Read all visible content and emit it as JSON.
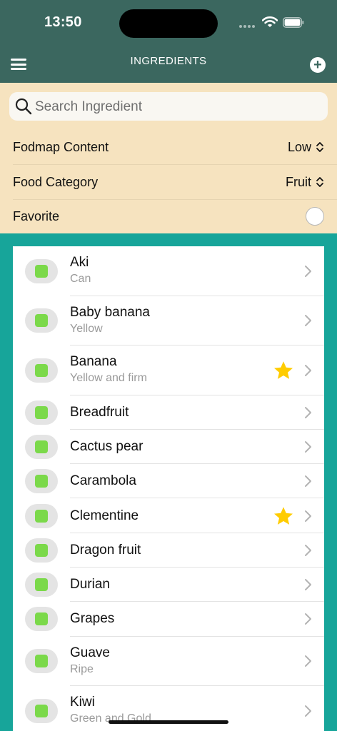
{
  "status_bar": {
    "time": "13:50"
  },
  "header": {
    "title": "INGREDIENTS",
    "add_label": "+"
  },
  "search": {
    "placeholder": "Search Ingredient"
  },
  "filters": {
    "fodmap": {
      "label": "Fodmap Content",
      "value": "Low"
    },
    "category": {
      "label": "Food Category",
      "value": "Fruit"
    },
    "favorite": {
      "label": "Favorite"
    }
  },
  "colors": {
    "header": "#3b675f",
    "filters_bg": "#f6e3bf",
    "page_bg": "#17a59a",
    "low_indicator": "#7bd94a",
    "star": "#ffcc00"
  },
  "ingredients": [
    {
      "name": "Aki",
      "detail": "Can",
      "favorite": false
    },
    {
      "name": "Baby banana",
      "detail": "Yellow",
      "favorite": false
    },
    {
      "name": "Banana",
      "detail": "Yellow and firm",
      "favorite": true
    },
    {
      "name": "Breadfruit",
      "detail": "",
      "favorite": false
    },
    {
      "name": "Cactus pear",
      "detail": "",
      "favorite": false
    },
    {
      "name": "Carambola",
      "detail": "",
      "favorite": false
    },
    {
      "name": "Clementine",
      "detail": "",
      "favorite": true
    },
    {
      "name": "Dragon fruit",
      "detail": "",
      "favorite": false
    },
    {
      "name": "Durian",
      "detail": "",
      "favorite": false
    },
    {
      "name": "Grapes",
      "detail": "",
      "favorite": false
    },
    {
      "name": "Guave",
      "detail": "Ripe",
      "favorite": false
    },
    {
      "name": "Kiwi",
      "detail": "Green and Gold",
      "favorite": false
    }
  ]
}
